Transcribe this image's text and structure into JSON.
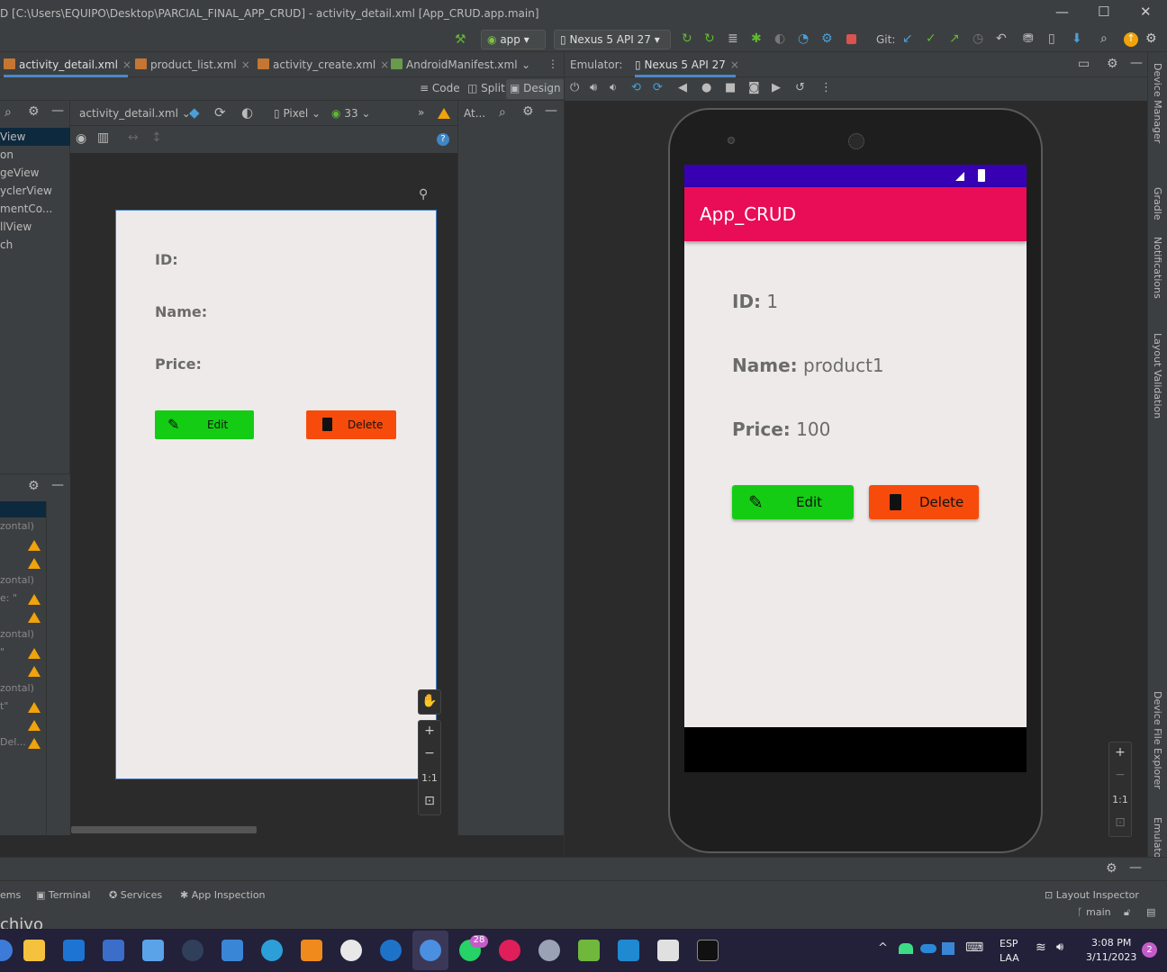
{
  "window": {
    "title": "D [C:\\Users\\EQUIPO\\Desktop\\PARCIAL_FINAL_APP_CRUD] - activity_detail.xml [App_CRUD.app.main]",
    "minimize": "—",
    "maximize": "☐",
    "close": "✕"
  },
  "toolbar": {
    "run_config": "app",
    "device": "Nexus 5 API 27",
    "git_label": "Git:"
  },
  "editor_tabs": [
    {
      "label": "activity_detail.xml",
      "active": true
    },
    {
      "label": "product_list.xml",
      "active": false
    },
    {
      "label": "activity_create.xml",
      "active": false
    },
    {
      "label": "AndroidManifest.xml",
      "active": false
    }
  ],
  "view_modes": {
    "code": "Code",
    "split": "Split",
    "design": "Design",
    "selected": "Design"
  },
  "design_toolbar": {
    "file": "activity_detail.xml",
    "device": "Pixel",
    "api": "33",
    "attributes_short": "At..."
  },
  "palette_items": [
    "View",
    "on",
    "geView",
    "yclerView",
    "mentCo...",
    "llView",
    "ch"
  ],
  "tree_rows": [
    {
      "text": "zontal)",
      "warn": false
    },
    {
      "text": "",
      "warn": true
    },
    {
      "text": "",
      "warn": true
    },
    {
      "text": "zontal)",
      "warn": false
    },
    {
      "text": "e: \"",
      "warn": true
    },
    {
      "text": "",
      "warn": true
    },
    {
      "text": "zontal)",
      "warn": false
    },
    {
      "text": "\"",
      "warn": true
    },
    {
      "text": "",
      "warn": true
    },
    {
      "text": "zontal)",
      "warn": false
    },
    {
      "text": "t\"",
      "warn": true
    },
    {
      "text": "",
      "warn": true
    },
    {
      "text": "Del...",
      "warn": true
    }
  ],
  "preview": {
    "id_label": "ID:",
    "name_label": "Name:",
    "price_label": "Price:",
    "edit_button": "Edit",
    "delete_button": "Delete",
    "edit_color": "#14cc14",
    "delete_color": "#f74b0c",
    "zoom_fit": "1:1"
  },
  "emulator": {
    "header_label": "Emulator:",
    "device_tab": "Nexus 5 API 27",
    "zoom_fit": "1:1",
    "app": {
      "title": "App_CRUD",
      "appbar_color": "#e90c57",
      "statusbar_color": "#3700b3",
      "id_label": "ID:",
      "id_value": "1",
      "name_label": "Name:",
      "name_value": "product1",
      "price_label": "Price:",
      "price_value": "100",
      "edit_button": "Edit",
      "delete_button": "Delete"
    }
  },
  "side_panels": [
    "Device Manager",
    "Gradle",
    "Notifications",
    "Layout Validation",
    "Device File Explorer",
    "Emulator"
  ],
  "bottom_tools": {
    "problems_fragment": "ems",
    "terminal": "Terminal",
    "services": "Services",
    "app_inspection": "App Inspection",
    "layout_inspector": "Layout Inspector",
    "branch": "main",
    "cut_text": "chivo"
  },
  "taskbar": {
    "whatsapp_badge": "28",
    "lang_top": "ESP",
    "lang_bottom": "LAA",
    "time": "3:08 PM",
    "date": "3/11/2023",
    "notif_count": "2"
  }
}
